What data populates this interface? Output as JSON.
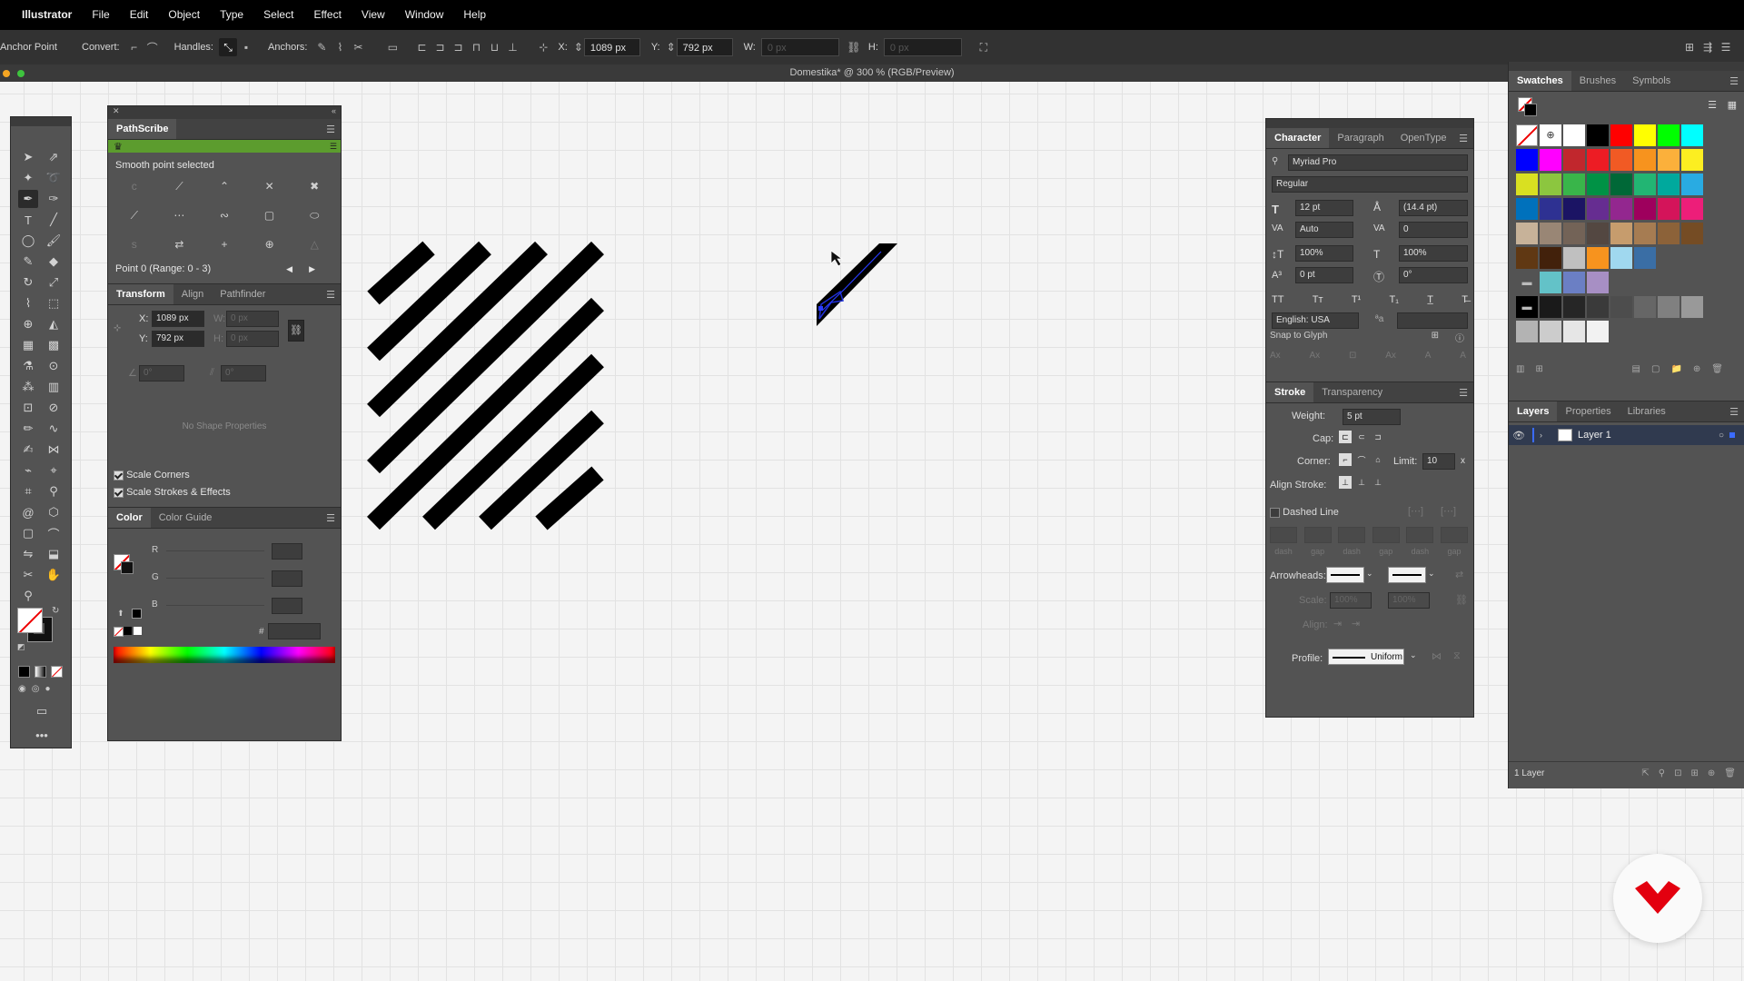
{
  "menu": {
    "app": "Illustrator",
    "items": [
      "File",
      "Edit",
      "Object",
      "Type",
      "Select",
      "Effect",
      "View",
      "Window",
      "Help"
    ]
  },
  "control": {
    "tool_label": "Anchor Point",
    "convert": "Convert:",
    "handles": "Handles:",
    "anchors": "Anchors:",
    "x_label": "X:",
    "x_value": "1089 px",
    "y_label": "Y:",
    "y_value": "792 px",
    "w_label": "W:",
    "w_value": "0 px",
    "h_label": "H:",
    "h_value": "0 px"
  },
  "document": {
    "title": "Domestika* @ 300 % (RGB/Preview)"
  },
  "pathscribe": {
    "title": "PathScribe",
    "status": "Smooth point selected",
    "point_info": "Point 0 (Range: 0 - 3)"
  },
  "transform": {
    "tabs": [
      "Transform",
      "Align",
      "Pathfinder"
    ],
    "x_label": "X:",
    "x_value": "1089 px",
    "y_label": "Y:",
    "y_value": "792 px",
    "w_label": "W:",
    "w_value": "0 px",
    "h_label": "H:",
    "h_value": "0 px",
    "angle_value": "0°",
    "shear_value": "0°",
    "no_shape": "No Shape Properties",
    "scale_corners": "Scale Corners",
    "scale_strokes": "Scale Strokes & Effects"
  },
  "color": {
    "tabs": [
      "Color",
      "Color Guide"
    ],
    "r_label": "R",
    "g_label": "G",
    "b_label": "B",
    "hex_label": "#"
  },
  "character": {
    "tabs": [
      "Character",
      "Paragraph",
      "OpenType"
    ],
    "font_family": "Myriad Pro",
    "font_style": "Regular",
    "size": "12 pt",
    "leading": "(14.4 pt)",
    "kerning": "Auto",
    "tracking": "0",
    "vscale": "100%",
    "hscale": "100%",
    "baseline": "0 pt",
    "rotation": "0°",
    "language": "English: USA",
    "snap": "Snap to Glyph"
  },
  "stroke": {
    "tabs": [
      "Stroke",
      "Transparency"
    ],
    "weight_label": "Weight:",
    "weight": "5 pt",
    "cap_label": "Cap:",
    "corner_label": "Corner:",
    "limit_label": "Limit:",
    "limit": "10",
    "align_label": "Align Stroke:",
    "dashed": "Dashed Line",
    "dash_labels": [
      "dash",
      "gap",
      "dash",
      "gap",
      "dash",
      "gap"
    ],
    "arrowheads_label": "Arrowheads:",
    "scale_label": "Scale:",
    "scale_a": "100%",
    "scale_b": "100%",
    "align2_label": "Align:",
    "profile_label": "Profile:",
    "profile": "Uniform"
  },
  "swatches": {
    "tabs": [
      "Swatches",
      "Brushes",
      "Symbols"
    ],
    "rows": [
      [
        "#ffffff",
        "#000000",
        "#ff0000",
        "#ffff00",
        "#00ff00",
        "#00ffff"
      ],
      [
        "#0000ff",
        "#ff00ff",
        "#c1272d",
        "#ed1c24",
        "#f15a24",
        "#f7931e",
        "#fbb03b",
        "#fcee21"
      ],
      [
        "#d9e021",
        "#8cc63f",
        "#39b54a",
        "#009245",
        "#006837",
        "#22b573",
        "#00a99d",
        "#29abe2"
      ],
      [
        "#0071bc",
        "#2e3192",
        "#1b1464",
        "#662d91",
        "#93278f",
        "#9e005d",
        "#d4145a",
        "#ed1e79"
      ],
      [
        "#c7b299",
        "#998675",
        "#736357",
        "#534741",
        "#c69c6d",
        "#a67c52",
        "#8c6239",
        "#754c24"
      ],
      [
        "#603813",
        "#42210b",
        "#c0c0c0",
        "#f7931e",
        "#a0d8ef",
        "#3a6ea5"
      ],
      [
        "#63c2c8",
        "#6b7fc4",
        "#a78fc4"
      ],
      [
        "#000000",
        "#1a1a1a",
        "#262626",
        "#3a3a3a",
        "#4d4d4d",
        "#666666",
        "#808080",
        "#999999"
      ],
      [
        "#b3b3b3",
        "#cccccc",
        "#e6e6e6",
        "#f2f2f2"
      ]
    ]
  },
  "layers": {
    "tabs": [
      "Layers",
      "Properties",
      "Libraries"
    ],
    "layer_name": "Layer 1",
    "count": "1 Layer"
  }
}
